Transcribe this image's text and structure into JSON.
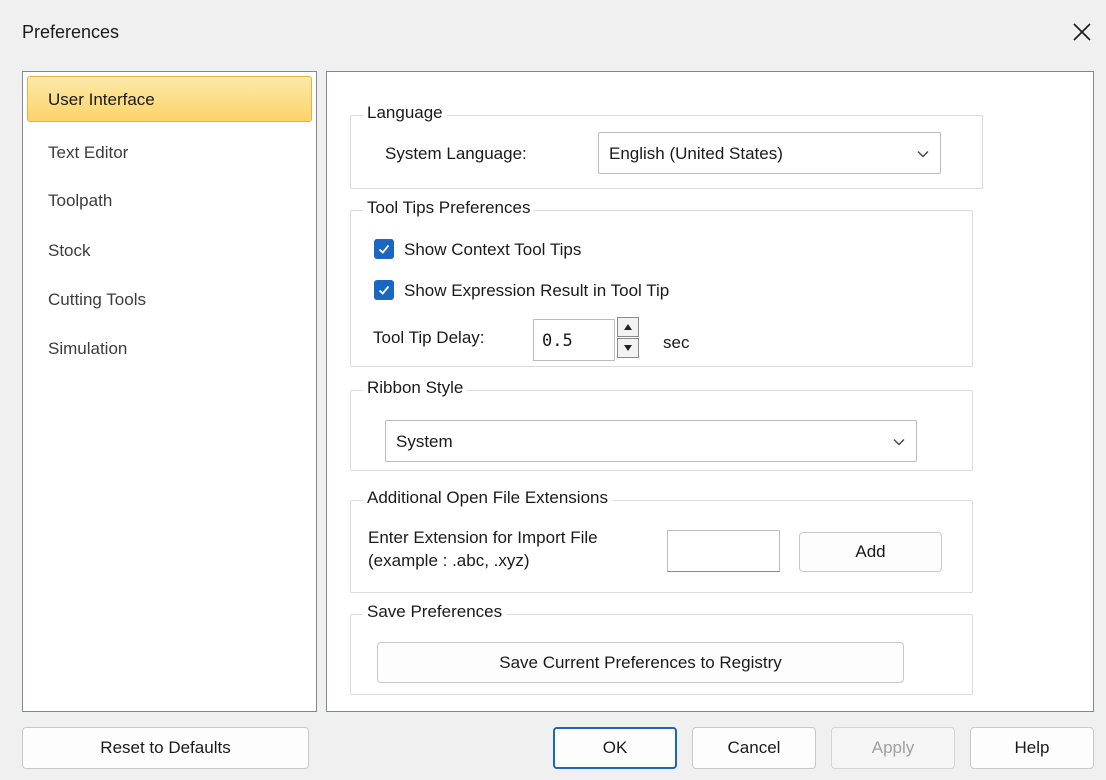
{
  "window": {
    "title": "Preferences",
    "close_icon": "close-icon"
  },
  "sidebar": {
    "items": [
      {
        "label": "User Interface",
        "selected": true
      },
      {
        "label": "Text Editor"
      },
      {
        "label": "Toolpath"
      },
      {
        "label": "Stock"
      },
      {
        "label": "Cutting Tools"
      },
      {
        "label": "Simulation"
      }
    ]
  },
  "language": {
    "group_title": "Language",
    "system_language_label": "System Language:",
    "system_language_value": "English (United States)"
  },
  "tooltips": {
    "group_title": "Tool Tips Preferences",
    "show_context_label": "Show Context Tool Tips",
    "show_context_checked": true,
    "show_expression_label": "Show Expression Result in Tool Tip",
    "show_expression_checked": true,
    "delay_label": "Tool Tip Delay:",
    "delay_value": "0.5",
    "delay_unit": "sec"
  },
  "ribbon": {
    "group_title": "Ribbon Style",
    "style_value": "System"
  },
  "extensions": {
    "group_title": "Additional Open File Extensions",
    "prompt_line1": "Enter Extension for Import File",
    "prompt_line2": "(example : .abc, .xyz)",
    "extension_value": "",
    "add_label": "Add"
  },
  "save": {
    "group_title": "Save Preferences",
    "save_label": "Save Current Preferences to Registry"
  },
  "footer": {
    "reset_label": "Reset to Defaults",
    "ok_label": "OK",
    "cancel_label": "Cancel",
    "apply_label": "Apply",
    "apply_enabled": false,
    "help_label": "Help"
  },
  "colors": {
    "accent": "#1a66c1",
    "selection": "#fbd46a"
  }
}
